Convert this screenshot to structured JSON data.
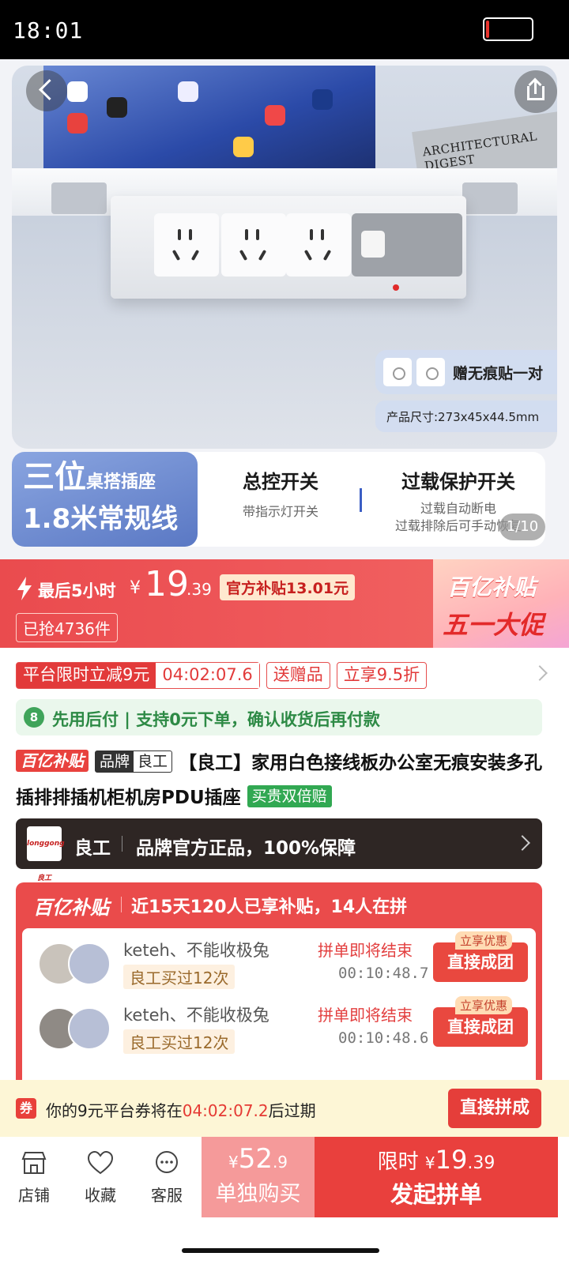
{
  "status_bar": {
    "time": "18:01"
  },
  "hero": {
    "book_title": "ARCHITECTURAL DIGEST",
    "gift_text": "赠无痕贴一对",
    "size_text": "产品尺寸:273x45x44.5mm",
    "feature_main_big": "三位",
    "feature_main_small": "桌搭插座",
    "feature_main_line2": "1.8米常规线",
    "feature1_title": "总控开关",
    "feature1_sub": "带指示灯开关",
    "feature2_title": "过载保护开关",
    "feature2_sub1": "过载自动断电",
    "feature2_sub2": "过载排除后可手动恢复",
    "image_counter": "1/10"
  },
  "price_banner": {
    "lead": "最后5小时",
    "currency": "¥",
    "price_int": "19",
    "price_dec": ".39",
    "subsidy": "官方补贴13.01元",
    "grabbed": "已抢4736件",
    "promo_line1": "百亿补贴",
    "promo_line2": "五一大促"
  },
  "tags": {
    "platform_cut_label": "平台限时立减9元",
    "countdown": "04:02:07.6",
    "gift": "送赠品",
    "discount": "立享9.5折"
  },
  "pay_after": {
    "icon": "8",
    "text": "先用后付 | 支持0元下单，确认收货后再付款"
  },
  "title": {
    "badge": "百亿补贴",
    "brand_key": "品牌",
    "brand_value": "良工",
    "text": "【良工】家用白色接线板办公室无痕安装多孔插排排插机柜机房PDU插座",
    "guarantee": "买贵双倍赔"
  },
  "brand_bar": {
    "logo_text": "longgong良工",
    "name": "良工",
    "desc": "品牌官方正品，100%保障"
  },
  "group_box": {
    "logo": "百亿补贴",
    "header": "近15天120人已享补贴，14人在拼",
    "rows": [
      {
        "names": "keteh、不能收极兔",
        "count": "良工买过12次",
        "ending": "拼单即将结束",
        "timer": "00:10:48.7",
        "badge": "立享优惠",
        "button": "直接成团"
      },
      {
        "names": "keteh、不能收极兔",
        "count": "良工买过12次",
        "ending": "拼单即将结束",
        "timer": "00:10:48.6",
        "badge": "立享优惠",
        "button": "直接成团"
      }
    ]
  },
  "coupon": {
    "icon": "券",
    "prefix": "你的9元平台券将在",
    "time": "04:02:07.2",
    "suffix": "后过期",
    "button": "直接拼成"
  },
  "bottom_bar": {
    "store": "店铺",
    "favorite": "收藏",
    "service": "客服",
    "alone_currency": "¥",
    "alone_price_int": "52",
    "alone_price_dec": ".9",
    "alone_label": "单独购买",
    "group_prefix": "限时",
    "group_currency": "¥",
    "group_price_int": "19",
    "group_price_dec": ".39",
    "group_label": "发起拼单"
  },
  "colors": {
    "accent": "#e9403d",
    "green": "#31a852",
    "feature_blue": "#5a78c4"
  }
}
